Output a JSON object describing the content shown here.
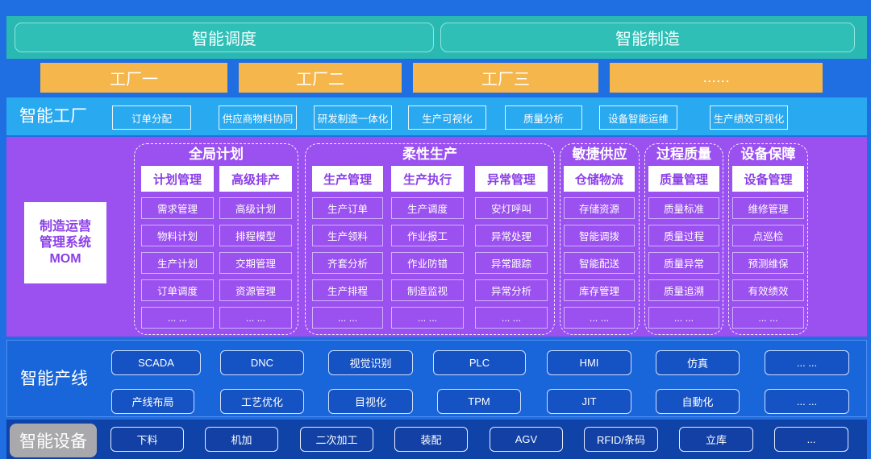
{
  "top_layer": {
    "left_label": "智能调度",
    "right_label": "智能制造"
  },
  "factories": [
    "工厂一",
    "工厂二",
    "工厂三",
    "......"
  ],
  "smart_factory": {
    "label": "智能工厂",
    "items": [
      "订单分配",
      "供应商物料协同",
      "研发制造一体化",
      "生产可视化",
      "质量分析",
      "设备智能运维",
      "生产绩效可视化"
    ]
  },
  "mom": {
    "system_label": [
      "制造运营",
      "管理系统",
      "MOM"
    ],
    "groups": [
      {
        "title": "全局计划",
        "modules": [
          {
            "header": "计划管理",
            "items": [
              "需求管理",
              "物料计划",
              "生产计划",
              "订单调度",
              "... ..."
            ]
          },
          {
            "header": "高级排产",
            "items": [
              "高级计划",
              "排程模型",
              "交期管理",
              "资源管理",
              "... ..."
            ]
          }
        ]
      },
      {
        "title": "柔性生产",
        "modules": [
          {
            "header": "生产管理",
            "items": [
              "生产订单",
              "生产领料",
              "齐套分析",
              "生产排程",
              "... ..."
            ]
          },
          {
            "header": "生产执行",
            "items": [
              "生产调度",
              "作业报工",
              "作业防错",
              "制造监视",
              "... ..."
            ]
          },
          {
            "header": "异常管理",
            "items": [
              "安灯呼叫",
              "异常处理",
              "异常跟踪",
              "异常分析",
              "... ..."
            ]
          }
        ]
      },
      {
        "title": "敏捷供应",
        "modules": [
          {
            "header": "仓储物流",
            "items": [
              "存储资源",
              "智能调拨",
              "智能配送",
              "库存管理",
              "... ..."
            ]
          }
        ]
      },
      {
        "title": "过程质量",
        "modules": [
          {
            "header": "质量管理",
            "items": [
              "质量标准",
              "质量过程",
              "质量异常",
              "质量追溯",
              "... ..."
            ]
          }
        ]
      },
      {
        "title": "设备保障",
        "modules": [
          {
            "header": "设备管理",
            "items": [
              "维修管理",
              "点巡检",
              "预测维保",
              "有效绩效",
              "... ..."
            ]
          }
        ]
      }
    ]
  },
  "production_line": {
    "label": "智能产线",
    "rows": [
      [
        "SCADA",
        "DNC",
        "视觉识别",
        "PLC",
        "HMI",
        "仿真",
        "... ..."
      ],
      [
        "产线布局",
        "工艺优化",
        "目视化",
        "TPM",
        "JIT",
        "自動化",
        "... ..."
      ]
    ]
  },
  "devices": {
    "label": "智能设备",
    "items": [
      "下料",
      "机加",
      "二次加工",
      "装配",
      "AGV",
      "RFID/条码",
      "立库",
      "..."
    ]
  },
  "colors": {
    "bg": "#1f6ee2",
    "teal": "#2ab9b2",
    "teal_box": "#2fbfb7",
    "orange": "#f5b64b",
    "light_blue": "#29a9ef",
    "purple": "#9b50f0",
    "mom_text": "#8b3fe8",
    "line_blue": "#1866da",
    "button_blue": "#1552c3",
    "device_blue": "#0f43a8",
    "device_button": "#1240a4",
    "gray": "#a9a9ad"
  }
}
